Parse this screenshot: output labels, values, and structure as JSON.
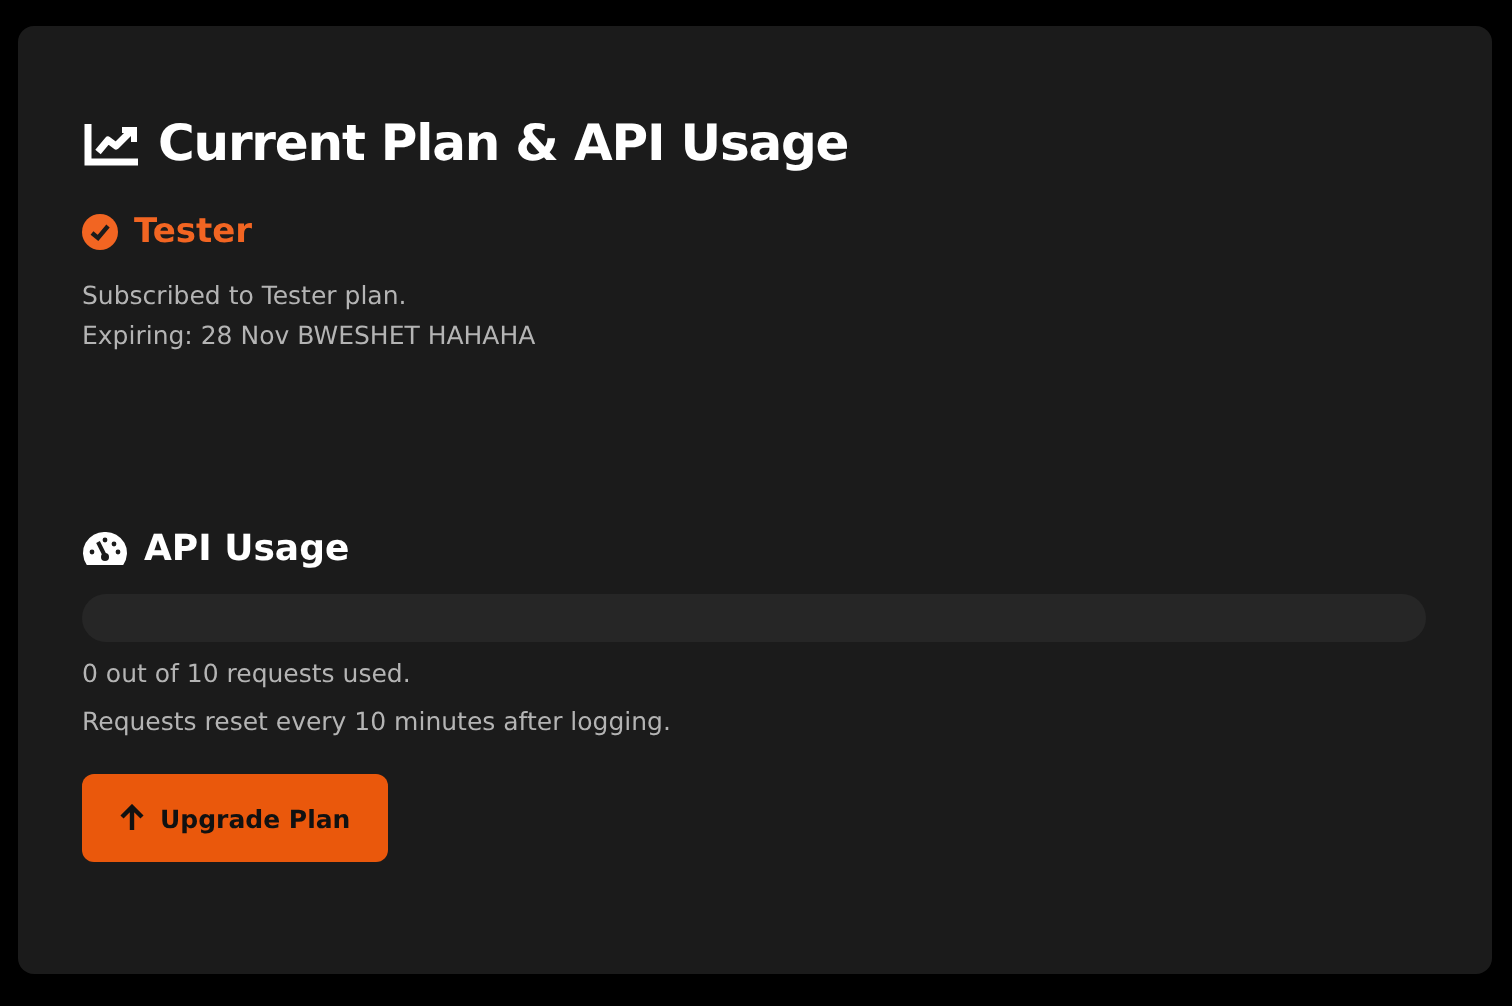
{
  "title": "Current Plan & API Usage",
  "plan": {
    "name": "Tester",
    "active": true,
    "lines": [
      "Subscribed to Tester plan.",
      "Expiring: 28 Nov BWESHET HAHAHA"
    ]
  },
  "usage": {
    "heading": "API Usage",
    "lines": [
      "0 out of 10 requests used.",
      "Requests reset every 10 minutes after logging."
    ]
  },
  "button": {
    "label": "Upgrade Plan"
  }
}
